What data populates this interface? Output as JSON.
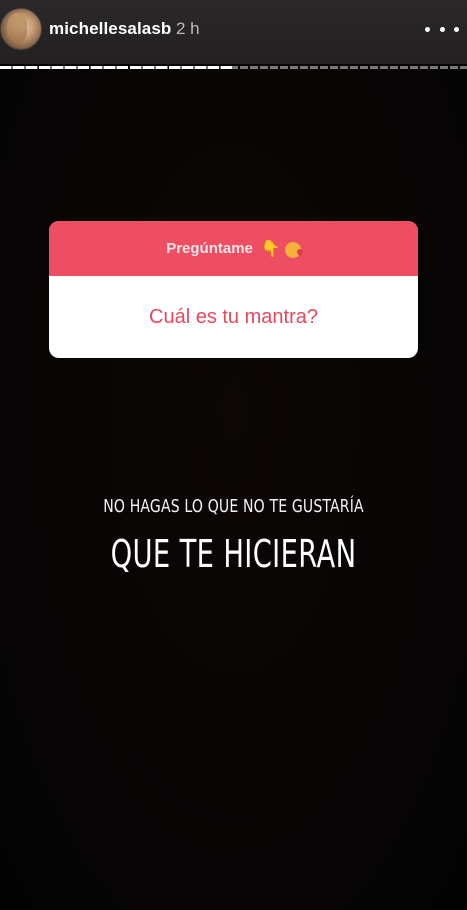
{
  "header": {
    "username": "michellesalasb",
    "timestamp": "2 h",
    "avatar_icon": "profile-photo-avatar",
    "more_icon": "more-horizontal-icon"
  },
  "progress": {
    "segments_total": 3,
    "current_segment": 1,
    "fraction_viewed": 0.5
  },
  "question_sticker": {
    "title": "Pregúntame",
    "emoji_1": "👇",
    "emoji_2": "😘",
    "answer": "Cuál es tu mantra?",
    "header_color": "#ee4e62",
    "answer_color": "#e8475c"
  },
  "quote": {
    "line_1": "NO HAGAS LO QUE NO TE GUSTARÍA",
    "line_2": "QUE TE HICIERAN"
  }
}
